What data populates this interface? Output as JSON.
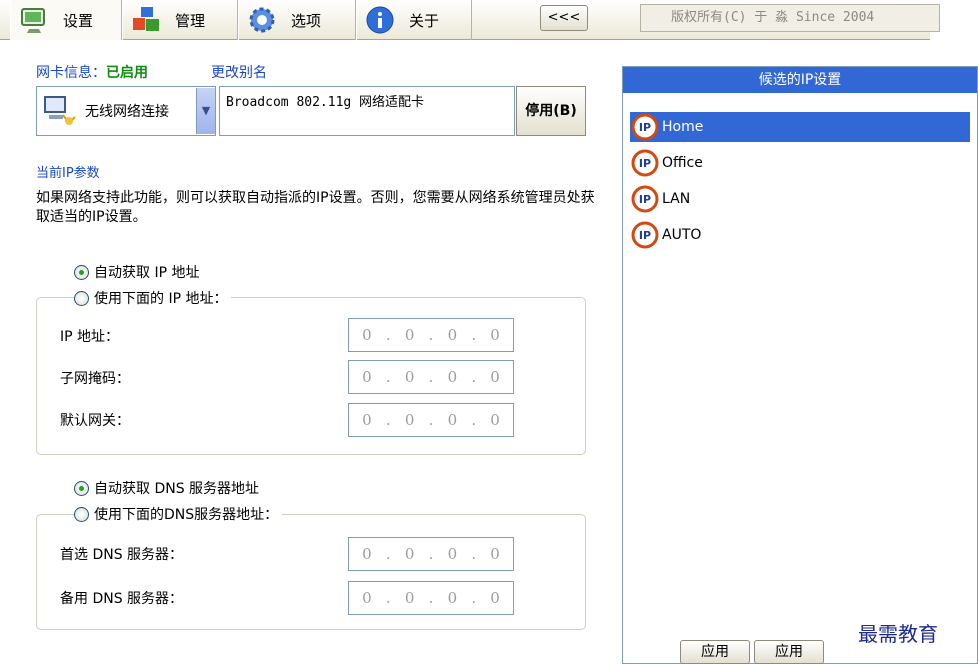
{
  "tabs": [
    {
      "label": "设置",
      "icon": "monitor-icon",
      "active": true
    },
    {
      "label": "管理",
      "icon": "blocks-icon",
      "active": false
    },
    {
      "label": "选项",
      "icon": "gear-icon",
      "active": false
    },
    {
      "label": "关于",
      "icon": "info-icon",
      "active": false
    }
  ],
  "toolbar": {
    "collapse_label": "<<<",
    "copyright": "版权所有(C) 于 淼 Since 2004"
  },
  "nic": {
    "info_label": "网卡信息：",
    "status": "已启用",
    "alias_link": "更改别名",
    "selected_name": "无线网络连接",
    "description": "Broadcom 802.11g 网络适配卡",
    "disable_button": "停用(B)"
  },
  "ip_params": {
    "title": "当前IP参数",
    "description": "如果网络支持此功能，则可以获取自动指派的IP设置。否则，您需要从网络系统管理员处获取适当的IP设置。",
    "auto_ip": "自动获取 IP 地址",
    "manual_ip": "使用下面的 IP 地址：",
    "ip_label": "IP  地址：",
    "mask_label": "子网掩码：",
    "gateway_label": "默认网关：",
    "ip_value": [
      "0",
      "0",
      "0",
      "0"
    ],
    "mask_value": [
      "0",
      "0",
      "0",
      "0"
    ],
    "gateway_value": [
      "0",
      "0",
      "0",
      "0"
    ]
  },
  "dns": {
    "auto_dns": "自动获取 DNS 服务器地址",
    "manual_dns": "使用下面的DNS服务器地址：",
    "primary_label": "首选 DNS 服务器：",
    "secondary_label": "备用 DNS 服务器：",
    "primary_value": [
      "0",
      "0",
      "0",
      "0"
    ],
    "secondary_value": [
      "0",
      "0",
      "0",
      "0"
    ]
  },
  "candidates": {
    "title": "候选的IP设置",
    "items": [
      "Home",
      "Office",
      "LAN",
      "AUTO"
    ],
    "selected": "Home"
  },
  "bottom_buttons": [
    "应用",
    "应用"
  ],
  "watermark": "最需教育",
  "colors": {
    "accent": "#3268d6",
    "link": "#1947c8",
    "status_green": "#108a10"
  }
}
